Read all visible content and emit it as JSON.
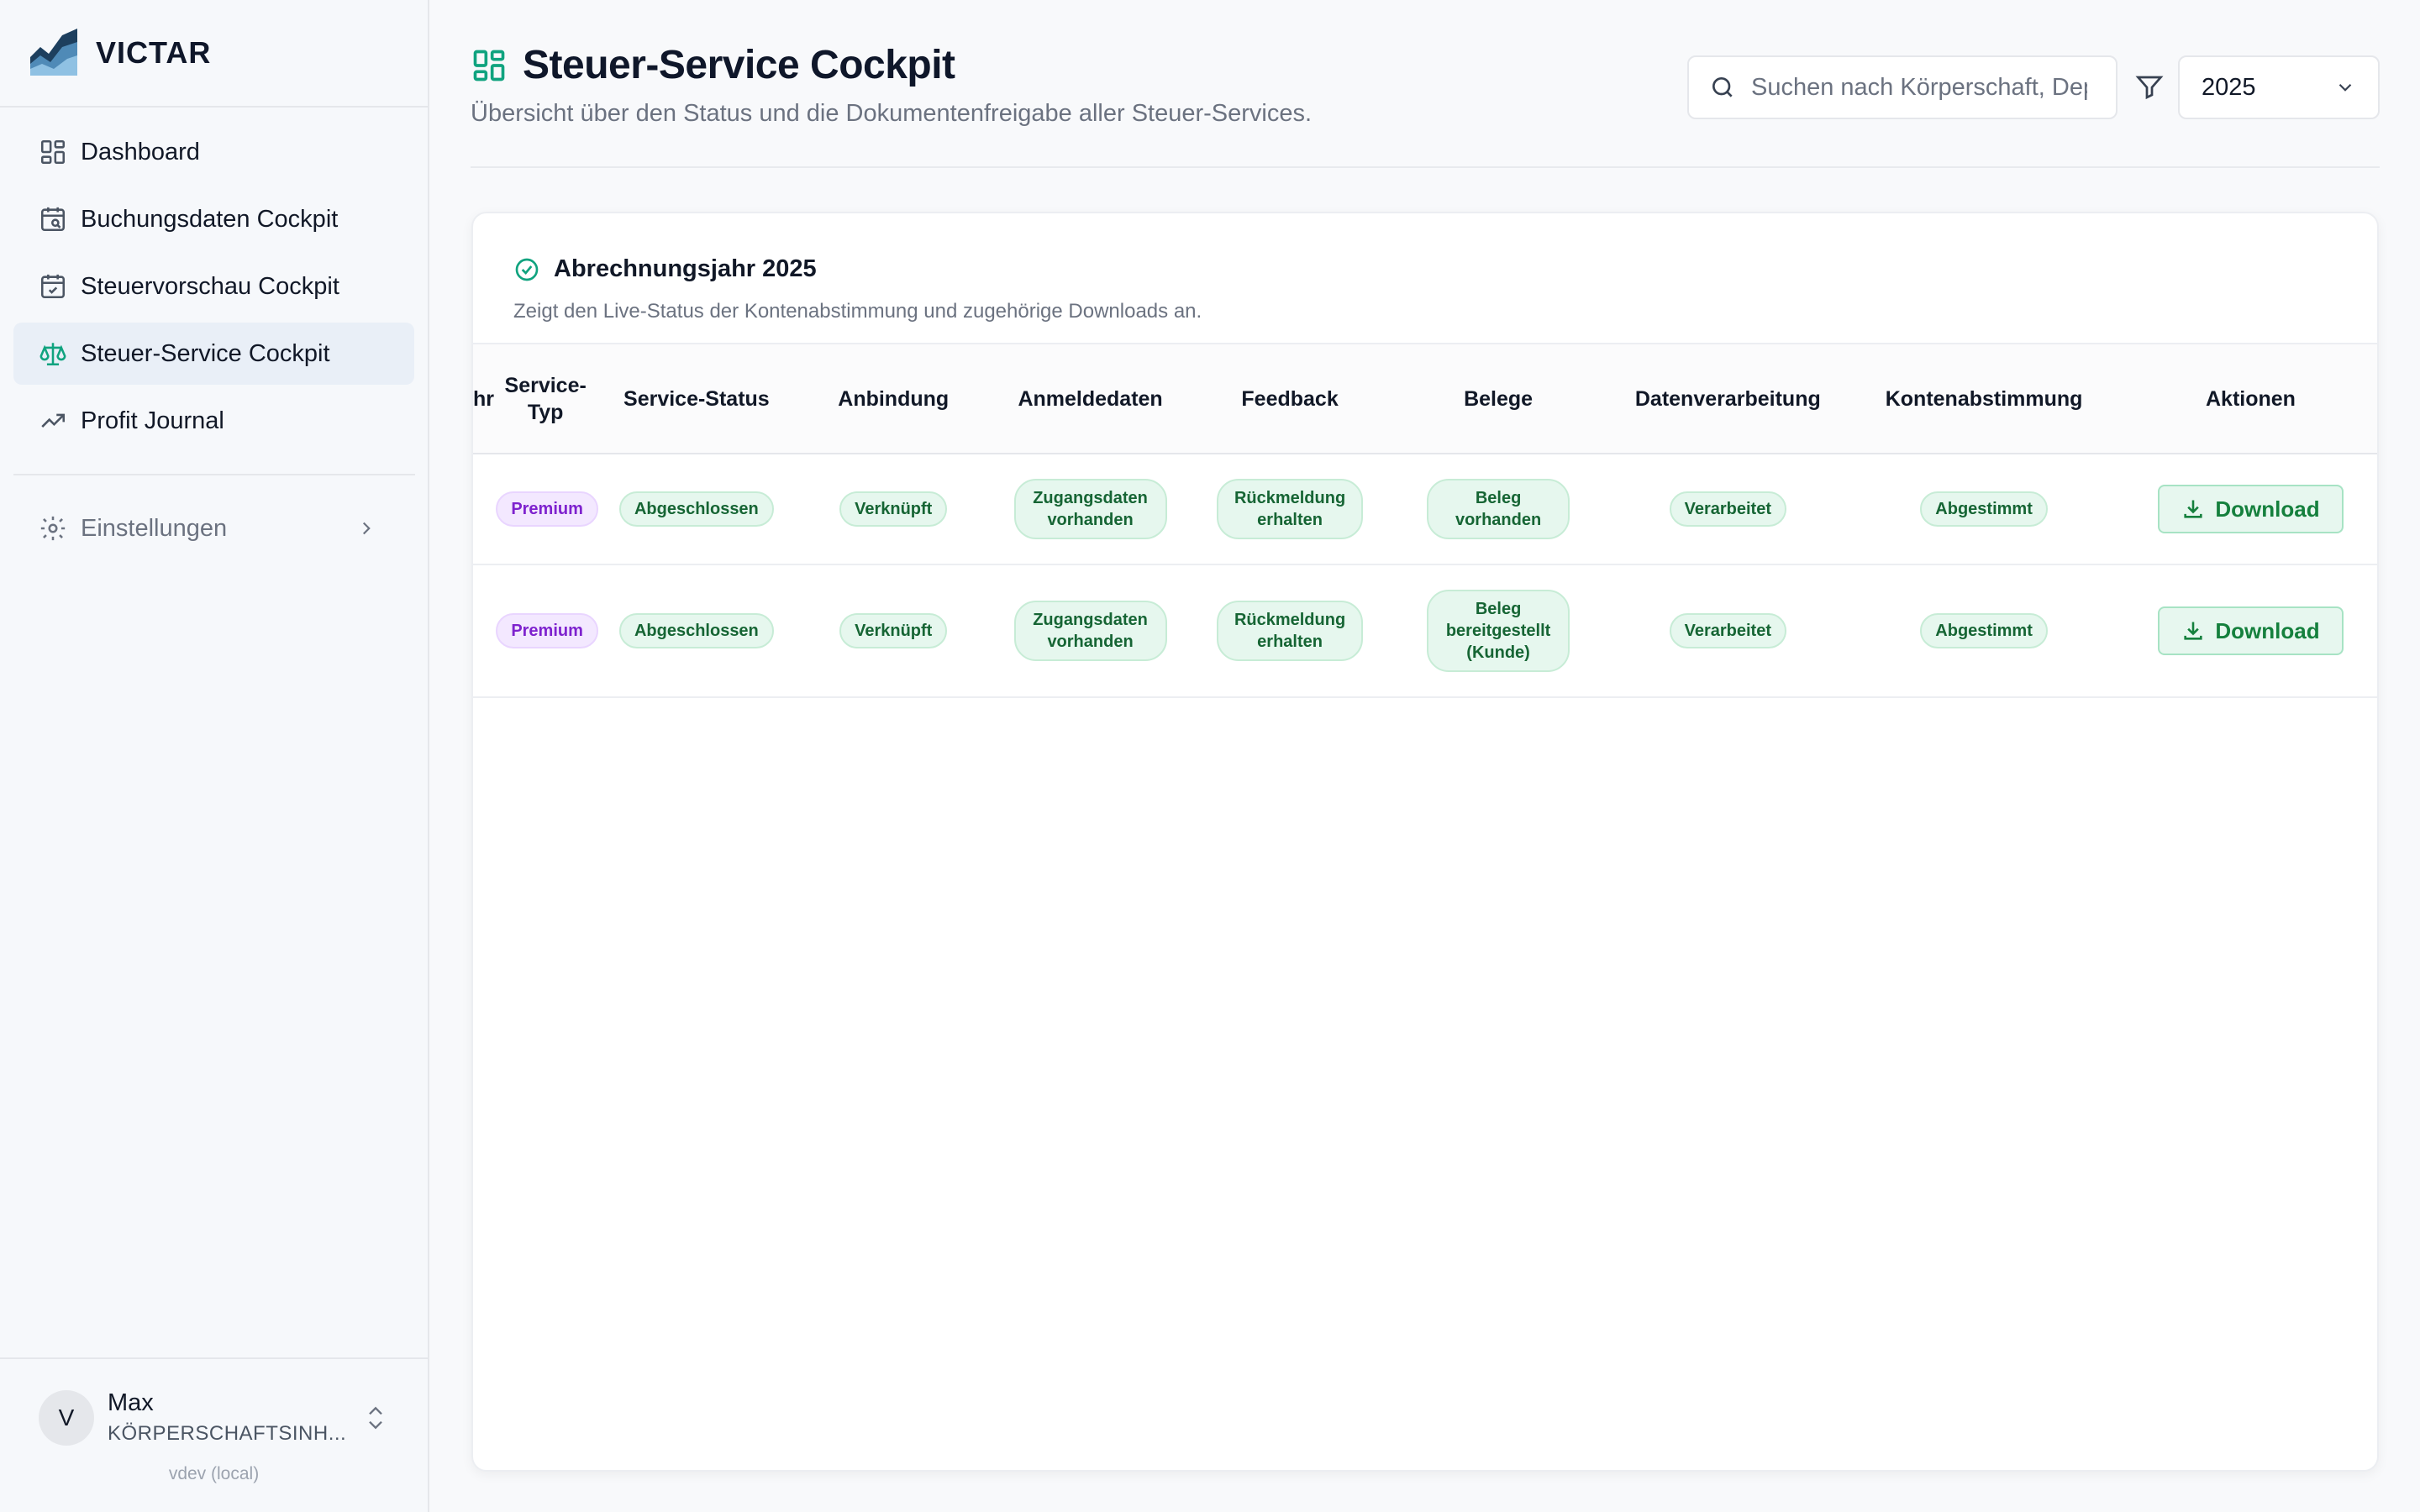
{
  "app": {
    "brand": "VICTAR",
    "version": "vdev (local)"
  },
  "sidebar": {
    "items": [
      {
        "label": "Dashboard",
        "icon": "dashboard-icon"
      },
      {
        "label": "Buchungsdaten Cockpit",
        "icon": "calendar-search-icon"
      },
      {
        "label": "Steuervorschau Cockpit",
        "icon": "calendar-check-icon"
      },
      {
        "label": "Steuer-Service Cockpit",
        "icon": "scale-icon",
        "active": true
      },
      {
        "label": "Profit Journal",
        "icon": "trending-up-icon"
      }
    ],
    "settings_label": "Einstellungen"
  },
  "user": {
    "initial": "V",
    "name": "Max",
    "org": "KÖRPERSCHAFTSINH..."
  },
  "header": {
    "title": "Steuer-Service Cockpit",
    "subtitle": "Übersicht über den Status und die Dokumentenfreigabe aller Steuer-Services.",
    "search_placeholder": "Suchen nach Körperschaft, Dep",
    "year": "2025"
  },
  "card": {
    "title": "Abrechnungsjahr 2025",
    "subtitle": "Zeigt den Live-Status der Kontenabstimmung und zugehörige Downloads an."
  },
  "table": {
    "columns": [
      "hr",
      "Service-Typ",
      "Service-Status",
      "Anbindung",
      "Anmeldedaten",
      "Feedback",
      "Belege",
      "Datenverarbeitung",
      "Kontenabstimmung",
      "Aktionen"
    ],
    "rows": [
      {
        "service_typ": "Premium",
        "service_status": "Abgeschlossen",
        "anbindung": "Verknüpft",
        "anmeldedaten": "Zugangsdaten vorhanden",
        "feedback": "Rückmeldung erhalten",
        "belege": "Beleg vorhanden",
        "datenverarbeitung": "Verarbeitet",
        "kontenabstimmung": "Abgestimmt",
        "action": "Download"
      },
      {
        "service_typ": "Premium",
        "service_status": "Abgeschlossen",
        "anbindung": "Verknüpft",
        "anmeldedaten": "Zugangsdaten vorhanden",
        "feedback": "Rückmeldung erhalten",
        "belege": "Beleg bereitgestellt (Kunde)",
        "datenverarbeitung": "Verarbeitet",
        "kontenabstimmung": "Abgestimmt",
        "action": "Download"
      }
    ]
  },
  "colors": {
    "accent": "#10a37f",
    "active_bg": "#e9eff7",
    "badge_green": "#e6f7ee",
    "badge_purple": "#f3e8ff"
  }
}
